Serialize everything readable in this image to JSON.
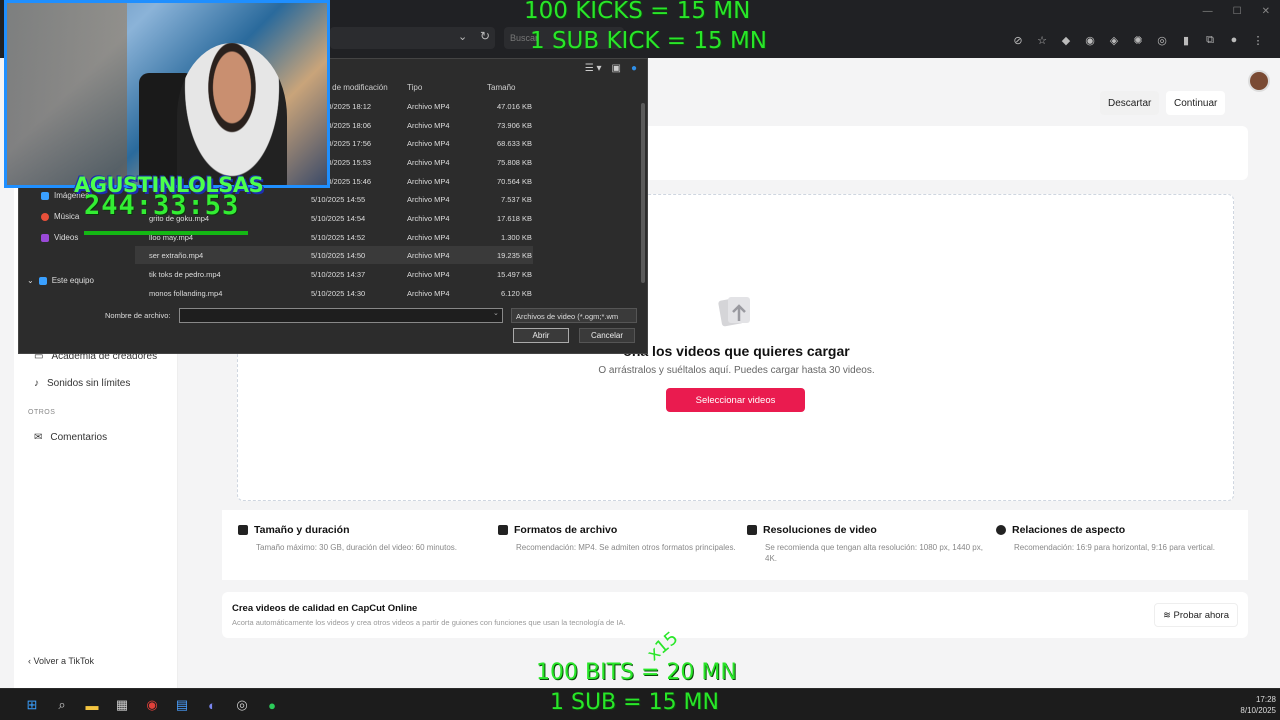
{
  "browser": {
    "search_placeholder": "Buscar",
    "icons": [
      "eye-off-icon",
      "star-icon",
      "extension-icon",
      "extension-icon",
      "extension-icon",
      "extension-icon",
      "extension-icon",
      "extension-icon",
      "puzzle-icon",
      "profile-icon",
      "menu-icon"
    ]
  },
  "overlay": {
    "top_line1": "100 KICKS = 15 MN",
    "top_line2": "1 SUB KICK  = 15 MN",
    "bottom_line1": "100 BITS = 20 MN",
    "bottom_line2": "1 SUB  = 15 MN",
    "x15": "x15",
    "stream_name": "AGUSTINLOLSAS",
    "timer": "244:33:53"
  },
  "dialog": {
    "columns": {
      "date": "ha de modificación",
      "type": "Tipo",
      "size": "Tamaño"
    },
    "nav": [
      {
        "label": "Imágenes"
      },
      {
        "label": "Música"
      },
      {
        "label": "Videos"
      },
      {
        "label": "Este equipo"
      }
    ],
    "files": [
      {
        "name": "",
        "date": "/10/2025 18:12",
        "type": "Archivo MP4",
        "size": "47.016 KB"
      },
      {
        "name": "",
        "date": "/10/2025 18:06",
        "type": "Archivo MP4",
        "size": "73.906 KB"
      },
      {
        "name": "",
        "date": "/10/2025 17:56",
        "type": "Archivo MP4",
        "size": "68.633 KB"
      },
      {
        "name": "",
        "date": "/10/2025 15:53",
        "type": "Archivo MP4",
        "size": "75.808 KB"
      },
      {
        "name": "",
        "date": "/10/2025 15:46",
        "type": "Archivo MP4",
        "size": "70.564 KB"
      },
      {
        "name": "",
        "date": "5/10/2025 14:55",
        "type": "Archivo MP4",
        "size": "7.537 KB"
      },
      {
        "name": "grito de goku.mp4",
        "date": "5/10/2025 14:54",
        "type": "Archivo MP4",
        "size": "17.618 KB"
      },
      {
        "name": "lloo may.mp4",
        "date": "5/10/2025 14:52",
        "type": "Archivo MP4",
        "size": "1.300 KB"
      },
      {
        "name": "ser extraño.mp4",
        "date": "5/10/2025 14:50",
        "type": "Archivo MP4",
        "size": "19.235 KB"
      },
      {
        "name": "tik toks de pedro.mp4",
        "date": "5/10/2025 14:37",
        "type": "Archivo MP4",
        "size": "15.497 KB"
      },
      {
        "name": "monos follanding.mp4",
        "date": "5/10/2025 14:30",
        "type": "Archivo MP4",
        "size": "6.120 KB"
      }
    ],
    "filename_label": "Nombre de archivo:",
    "filename_value": "",
    "filetype_value": "Archivos de video (*.ogm;*.wm",
    "open_label": "Abrir",
    "cancel_label": "Cancelar"
  },
  "sidebar": {
    "items": [
      {
        "label": "Academia de creadores"
      },
      {
        "label": "Sonidos sin límites"
      }
    ],
    "section_otros": "OTROS",
    "comentarios": "Comentarios",
    "back": "Volver a TikTok"
  },
  "main": {
    "discard": "Descartar",
    "continue": "Continuar",
    "drop_title": "ona los videos que quieres cargar",
    "drop_sub": "O arrástralos y suéltalos aquí. Puedes cargar hasta 30 videos.",
    "select_button": "Seleccionar videos",
    "info": [
      {
        "title": "Tamaño y duración",
        "desc": "Tamaño máximo: 30 GB, duración del video: 60 minutos."
      },
      {
        "title": "Formatos de archivo",
        "desc": "Recomendación: MP4. Se admiten otros formatos principales."
      },
      {
        "title": "Resoluciones de video",
        "desc": "Se recomienda que tengan alta resolución: 1080 px, 1440 px, 4K."
      },
      {
        "title": "Relaciones de aspecto",
        "desc": "Recomendación: 16:9 para horizontal, 9:16 para vertical."
      }
    ],
    "promo_title": "Crea videos de calidad en CapCut Online",
    "promo_desc": "Acorta automáticamente los videos y crea otros videos a partir de guiones con funciones que usan la tecnología de IA.",
    "promo_button": "Probar ahora"
  },
  "taskbar": {
    "time": "17:28",
    "date": "8/10/2025"
  }
}
